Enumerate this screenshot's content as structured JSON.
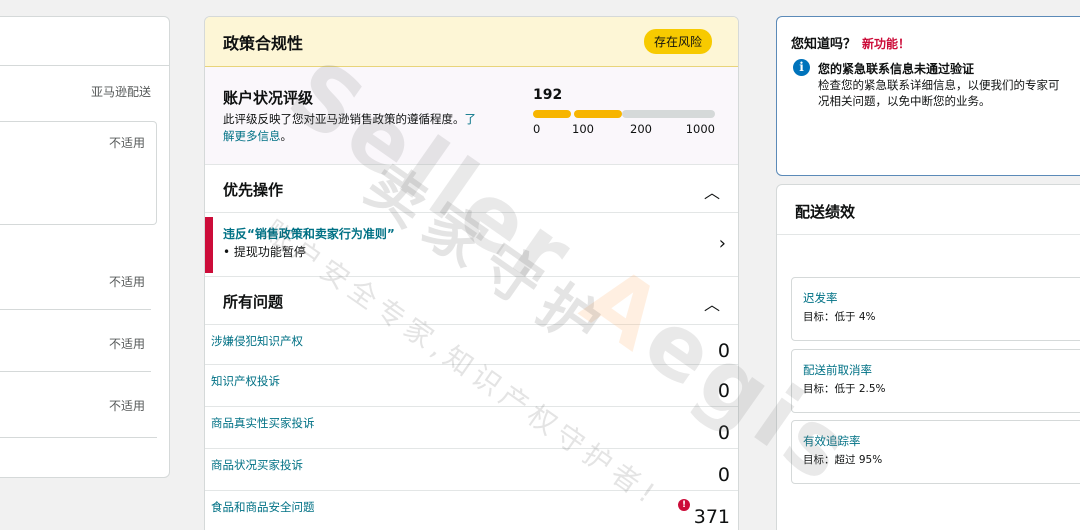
{
  "left": {
    "column_header": "亚马逊配送",
    "not_applicable": "不适用"
  },
  "policy": {
    "title": "政策合规性",
    "badge": "存在风险",
    "rating": {
      "title": "账户状况评级",
      "desc": "此评级反映了您对亚马逊销售政策的遵循程度。",
      "link_a": "了",
      "link_b": "解更多信息",
      "desc_end": "。",
      "score": "192",
      "ticks": [
        "0",
        "100",
        "200",
        "1000"
      ]
    },
    "priority": {
      "title": "优先操作",
      "item_title": "违反“销售政策和卖家行为准则”",
      "item_sub": "• 提现功能暂停"
    },
    "issues": {
      "title": "所有问题",
      "rows": [
        {
          "label": "涉嫌侵犯知识产权",
          "count": "0"
        },
        {
          "label": "知识产权投诉",
          "count": "0"
        },
        {
          "label": "商品真实性买家投诉",
          "count": "0"
        },
        {
          "label": "商品状况买家投诉",
          "count": "0"
        },
        {
          "label": "食品和商品安全问题",
          "count": "371"
        }
      ]
    }
  },
  "notice": {
    "heading": "您知道吗？",
    "new_tag": "新功能！",
    "title": "您的紧急联系信息未通过验证",
    "body_1": "检查您的紧急联系详细信息，以便我们的专家可",
    "body_2": "况相关问题，以免中断您的业务。"
  },
  "shipping": {
    "title": "配送绩效",
    "metrics": [
      {
        "name": "迟发率",
        "target": "目标：低于 4%"
      },
      {
        "name": "配送前取消率",
        "target": "目标：低于 2.5%"
      },
      {
        "name": "有效追踪率",
        "target": "目标：超过 95%"
      }
    ]
  },
  "watermark": {
    "en_1": "Seller ",
    "en_2": "A",
    "en_3": "egis",
    "cn": "卖家守护",
    "sub": "账户安全专家,知识产权守护者!"
  },
  "colors": {
    "link": "#007185",
    "risk_badge": "#f7ca00",
    "alert": "#cc0c39",
    "bar_fill": "#f7b500"
  }
}
